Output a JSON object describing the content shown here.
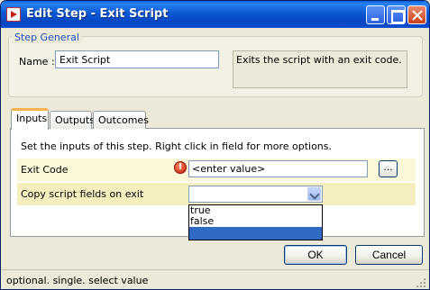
{
  "window": {
    "title": "Edit Step - Exit Script"
  },
  "step_general": {
    "legend": "Step General",
    "name_label": "Name :",
    "name_value": "Exit Script",
    "description": "Exits the script with an exit code."
  },
  "tabs": [
    {
      "label": "Inputs",
      "active": true
    },
    {
      "label": "Outputs",
      "active": false
    },
    {
      "label": "Outcomes",
      "active": false
    }
  ],
  "inputs": {
    "hint": "Set the inputs of this step.  Right click in field for more options.",
    "exit_code": {
      "label": "Exit Code",
      "value": "<enter value>",
      "browse_label": "..."
    },
    "copy_fields": {
      "label": "Copy script fields on exit",
      "selected": "",
      "options": [
        "true",
        "false",
        ""
      ]
    }
  },
  "buttons": {
    "ok": "OK",
    "cancel": "Cancel"
  },
  "status": "optional. single. select value",
  "icons": {
    "app": "app-icon",
    "warning": "error-icon",
    "combo": "chevron-down-icon"
  },
  "colors": {
    "title_bar": "#0b58d2",
    "active_tab_accent": "#f9b14b",
    "selection": "#316ac5",
    "row_highlight": "#fbf7d9",
    "legend_text": "#2050c0"
  }
}
